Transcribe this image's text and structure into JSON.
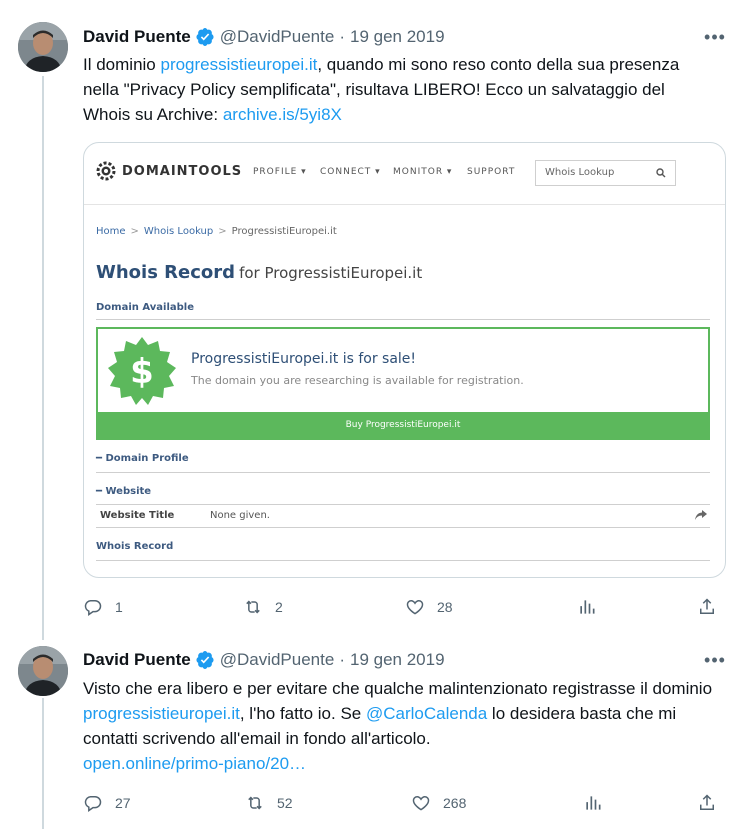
{
  "colors": {
    "text": "#0f1419",
    "secondary": "#536471",
    "link": "#1d9bf0",
    "verified": "#1d9bf0",
    "domaintools_green": "#5cb85c",
    "domaintools_blue": "#2e4f76"
  },
  "tweets": [
    {
      "author": {
        "name": "David Puente",
        "handle": "@DavidPuente",
        "verified_icon": "verified-badge-icon"
      },
      "dot": "·",
      "date": "19 gen 2019",
      "text": {
        "p1": "Il dominio ",
        "link1": "progressistieuropei.it",
        "p2": ", quando mi sono reso conto della sua presenza nella \"Privacy Policy semplificata\", risultava LIBERO! Ecco un salvataggio del Whois su Archive: ",
        "link2": "archive.is/5yi8X"
      },
      "stats": {
        "replies": "1",
        "retweets": "2",
        "likes": "28"
      }
    },
    {
      "author": {
        "name": "David Puente",
        "handle": "@DavidPuente",
        "verified_icon": "verified-badge-icon"
      },
      "dot": "·",
      "date": "19 gen 2019",
      "text": {
        "p1": "Visto che era libero e per evitare che qualche malintenzionato registrasse il dominio ",
        "link1": "progressistieuropei.it",
        "p2": ", l'ho fatto io. Se ",
        "mention": "@CarloCalenda",
        "p3": " lo desidera basta che mi contatti scrivendo all'email in fondo all'articolo.",
        "link2": "open.online/primo-piano/20…"
      },
      "stats": {
        "replies": "27",
        "retweets": "52",
        "likes": "268"
      }
    }
  ],
  "card": {
    "logo": "DOMAINTOOLS",
    "nav": [
      "PROFILE ▾",
      "CONNECT ▾",
      "MONITOR ▾",
      "SUPPORT"
    ],
    "search_placeholder": "Whois Lookup",
    "breadcrumb": [
      "Home",
      "Whois Lookup",
      "ProgressistiEuropei.it"
    ],
    "breadcrumb_sep": ">",
    "title_main": "Whois Record",
    "title_for": "for ProgressistiEuropei.it",
    "domain_available": "Domain Available",
    "sale_headline": "ProgressistiEuropei.it is for sale!",
    "sale_sub": "The domain you are researching is available for registration.",
    "buy_button": "Buy ProgressistiEuropei.it",
    "section_domain_profile": "━ Domain Profile",
    "section_website": "━ Website",
    "website_title_label": "Website Title",
    "website_title_value": "None given.",
    "section_whois_record": "Whois Record"
  }
}
